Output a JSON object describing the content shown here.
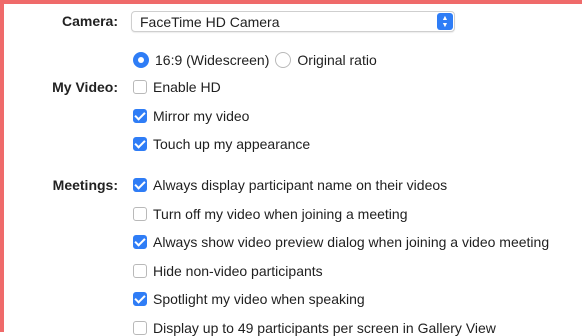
{
  "camera": {
    "label": "Camera:",
    "value": "FaceTime HD Camera"
  },
  "my_video": {
    "label": "My Video:",
    "ratio_options": [
      {
        "label": "16:9 (Widescreen)",
        "selected": true
      },
      {
        "label": "Original ratio",
        "selected": false
      }
    ],
    "options": [
      {
        "label": "Enable HD",
        "checked": false
      },
      {
        "label": "Mirror my video",
        "checked": true
      },
      {
        "label": "Touch up my appearance",
        "checked": true
      }
    ]
  },
  "meetings": {
    "label": "Meetings:",
    "options": [
      {
        "label": "Always display participant name on their videos",
        "checked": true
      },
      {
        "label": "Turn off my video when joining a meeting",
        "checked": false
      },
      {
        "label": "Always show video preview dialog when joining a video meeting",
        "checked": true
      },
      {
        "label": "Hide non-video participants",
        "checked": false
      },
      {
        "label": "Spotlight my video when speaking",
        "checked": true
      },
      {
        "label": "Display up to 49 participants per screen in Gallery View",
        "checked": false
      }
    ]
  },
  "colors": {
    "accent": "#2f7df6",
    "frame": "#ef6a6a"
  }
}
